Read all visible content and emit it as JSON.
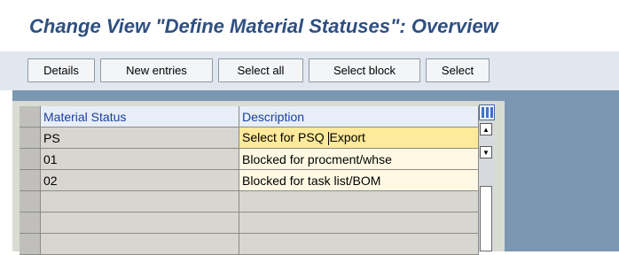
{
  "window": {
    "title": "Change View \"Define Material Statuses\": Overview"
  },
  "toolbar": {
    "details": "Details",
    "new_entries": "New entries",
    "select_all": "Select all",
    "select_block": "Select block",
    "select": "Select"
  },
  "table": {
    "columns": {
      "status": "Material Status",
      "description": "Description"
    },
    "rows": [
      {
        "status": "PS",
        "description": "Select for PSQ Export"
      },
      {
        "status": "01",
        "description": "Blocked for procment/whse"
      },
      {
        "status": "02",
        "description": "Blocked for task list/BOM"
      }
    ]
  },
  "icons": {
    "table_settings": "table-settings-icon",
    "scroll_up": "arrow-up-icon",
    "scroll_down": "arrow-down-icon"
  },
  "colors": {
    "title": "#2e4f80",
    "header_text": "#1b3e9c",
    "active_cell": "#ffe99a",
    "background": "#7c97b2"
  }
}
